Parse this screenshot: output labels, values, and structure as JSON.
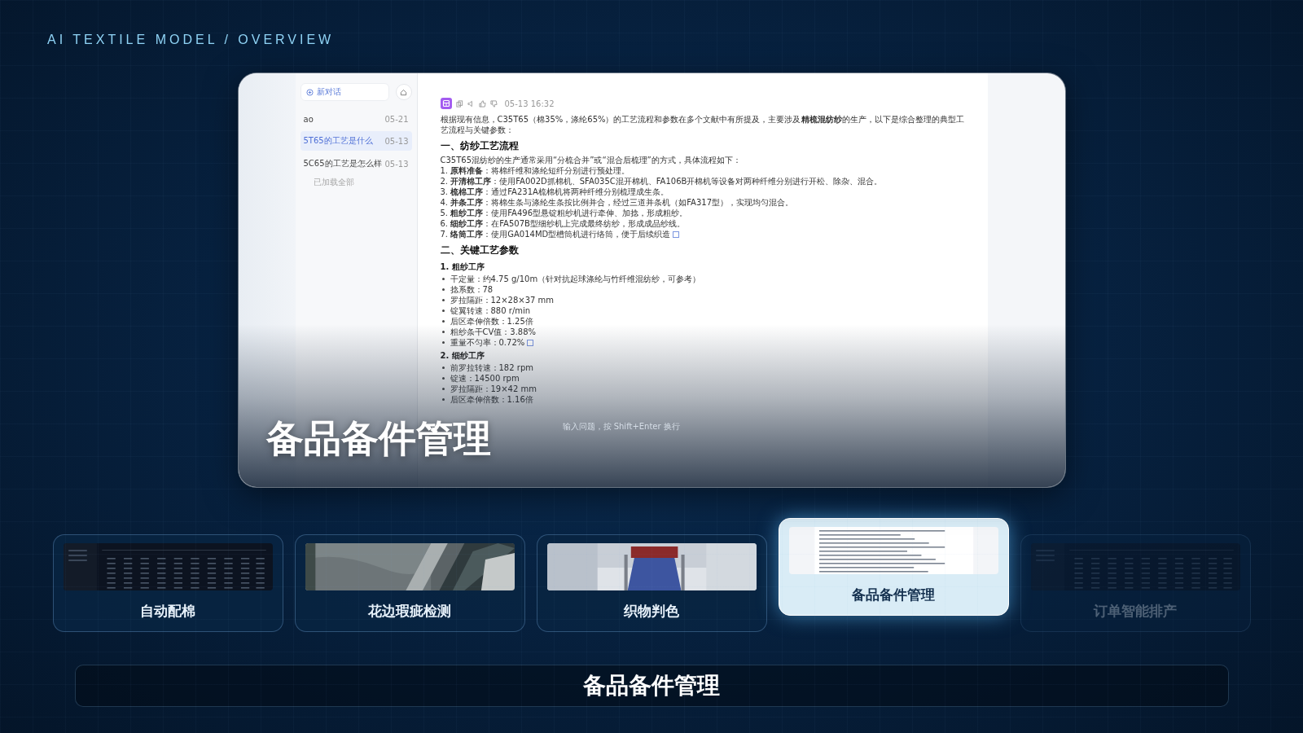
{
  "header": {
    "breadcrumb": "AI TEXTILE MODEL / OVERVIEW"
  },
  "preview": {
    "title": "备品备件管理",
    "sidebar": {
      "new_chat": "新对话",
      "conversations": [
        {
          "title": "ao",
          "date": "05-21",
          "selected": false
        },
        {
          "title": "5T65的工艺是什么",
          "date": "05-13",
          "selected": true
        },
        {
          "title": "5C65的工艺是怎么样",
          "date": "05-13",
          "selected": false
        }
      ],
      "load_note": "已加载全部"
    },
    "message": {
      "time": "05-13 16:32",
      "intro": "根据现有信息，C35T65（棉35%，涤纶65%）的工艺流程和参数在多个文献中有所提及，主要涉及**精梳混纺纱**的生产，以下是综合整理的典型工艺流程与关键参数：",
      "process": {
        "heading": "一、纺纱工艺流程",
        "lead": "C35T65混纺纱的生产通常采用“分梳合并”或“混合后梳理”的方式，具体流程如下：",
        "steps": [
          {
            "text": "1. **原料准备**：将棉纤维和涤纶短纤分别进行预处理。",
            "cited": false
          },
          {
            "text": "2. **开清棉工序**：使用FA002D抓棉机、SFA035C混开棉机、FA106B开棉机等设备对两种纤维分别进行开松、除杂、混合。",
            "cited": false
          },
          {
            "text": "3. **梳棉工序**：通过FA231A梳棉机将两种纤维分别梳理成生条。",
            "cited": false
          },
          {
            "text": "4. **并条工序**：将棉生条与涤纶生条按比例并合，经过三道并条机（如FA317型），实现均匀混合。",
            "cited": false
          },
          {
            "text": "5. **粗纱工序**：使用FA496型悬锭粗纱机进行牵伸、加捻，形成粗纱。",
            "cited": false
          },
          {
            "text": "6. **细纱工序**：在FA507B型细纱机上完成最终纺纱，形成成品纱线。",
            "cited": false
          },
          {
            "text": "7. **络筒工序**：使用GA014MD型槽筒机进行络筒，便于后续织造",
            "cited": true
          }
        ]
      },
      "parameters": {
        "heading": "二、关键工艺参数",
        "groups": [
          {
            "title": "1. 粗纱工序",
            "items": [
              {
                "text": "干定量：约4.75 g/10m（针对抗起球涤纶与竹纤维混纺纱，可参考）",
                "cited": false
              },
              {
                "text": "捻系数：78",
                "cited": false
              },
              {
                "text": "罗拉隔距：12×28×37 mm",
                "cited": false
              },
              {
                "text": "锭翼转速：880 r/min",
                "cited": false
              },
              {
                "text": "后区牵伸倍数：1.25倍",
                "cited": false
              },
              {
                "text": "粗纱条干CV值：3.88%",
                "cited": false
              },
              {
                "text": "重量不匀率：0.72%",
                "cited": true
              }
            ]
          },
          {
            "title": "2. 细纱工序",
            "items": [
              {
                "text": "前罗拉转速：182 rpm",
                "cited": false
              },
              {
                "text": "锭速：14500 rpm",
                "cited": false
              },
              {
                "text": "罗拉隔距：19×42 mm",
                "cited": false
              },
              {
                "text": "后区牵伸倍数：1.16倍",
                "cited": false
              }
            ]
          }
        ]
      }
    },
    "input_hint": "输入问题，按 Shift+Enter 换行"
  },
  "cards": [
    {
      "label": "自动配棉",
      "kind": "dark-table",
      "selected": false,
      "dimmed": false
    },
    {
      "label": "花边瑕疵检测",
      "kind": "lace-photo",
      "selected": false,
      "dimmed": false
    },
    {
      "label": "织物判色",
      "kind": "fabric-photo",
      "selected": false,
      "dimmed": false
    },
    {
      "label": "备品备件管理",
      "kind": "chat-screen",
      "selected": true,
      "dimmed": false
    },
    {
      "label": "订单智能排产",
      "kind": "dark-table",
      "selected": false,
      "dimmed": true
    }
  ],
  "caption": "备品备件管理"
}
